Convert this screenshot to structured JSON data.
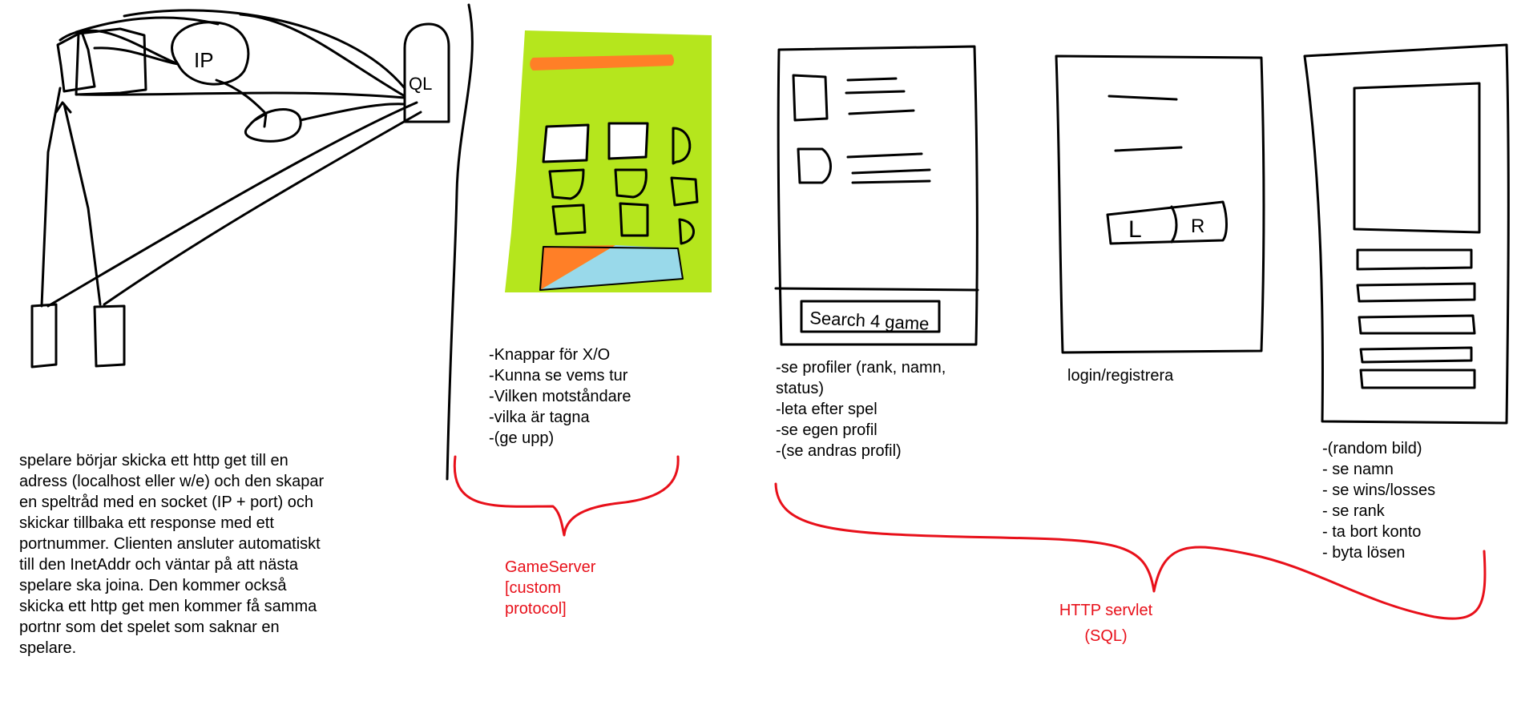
{
  "colors": {
    "ink": "#000000",
    "annotation": "#e8101a",
    "board_green": "#b5e61d",
    "orange": "#ff7f27",
    "light_blue": "#99d9ea",
    "paper": "#ffffff"
  },
  "architecture_sketch": {
    "ip_node_label": "IP",
    "sql_node_label": "QL"
  },
  "architecture_description": "spelare börjar skicka ett http get till en\nadress (localhost eller w/e) och den skapar\nen speltråd med en socket (IP + port) och\nskickar tillbaka ett response med ett\nportnummer. Clienten ansluter automatiskt\ntill den InetAddr och väntar på att nästa\nspelare ska joina. Den kommer också\nskicka ett http get men kommer få samma\nportnr som det spelet som saknar en\nspelare.",
  "game_screen": {
    "notes": "-Knappar för X/O\n-Kunna se vems tur\n-Vilken motståndare\n-vilka är tagna\n-(ge upp)"
  },
  "lobby_screen": {
    "search_label": "Search 4 game",
    "notes": "-se profiler (rank, namn,\nstatus)\n-leta efter spel\n-se egen profil\n-(se andras profil)"
  },
  "login_screen": {
    "login_button": "L",
    "register_button": "R",
    "caption": "login/registrera"
  },
  "profile_screen": {
    "notes": "-(random bild)\n- se namn\n- se wins/losses\n- se rank\n- ta bort konto\n- byta lösen"
  },
  "groupings": {
    "gameserver_label": "GameServer\n[custom\nprotocol]",
    "http_label": "HTTP servlet\n(SQL)"
  }
}
